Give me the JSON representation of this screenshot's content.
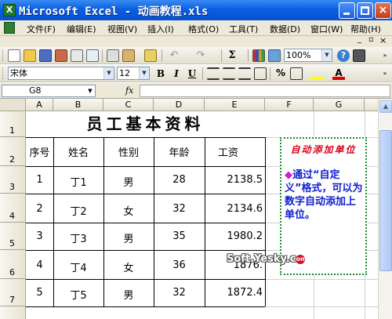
{
  "window": {
    "title": "Microsoft Excel - 动画教程.xls",
    "app_icon": "excel-icon"
  },
  "menu": {
    "items": [
      "文件(F)",
      "编辑(E)",
      "视图(V)",
      "插入(I)",
      "格式(O)",
      "工具(T)",
      "数据(D)",
      "窗口(W)",
      "帮助(H)"
    ],
    "mdi_controls": [
      "_",
      "▫",
      "×"
    ]
  },
  "toolbar": {
    "zoom": "100%",
    "font_name": "宋体",
    "font_size": "12",
    "bold": "B",
    "italic": "I",
    "underline": "U",
    "percent": "%",
    "sigma": "Σ",
    "accent_colors": {
      "fill": "#ffff00",
      "font": "#e00000"
    }
  },
  "formula_bar": {
    "cell_ref": "G8",
    "fx": "fx",
    "content": ""
  },
  "sheet": {
    "columns": [
      "A",
      "B",
      "C",
      "D",
      "E",
      "F",
      "G"
    ],
    "rows": [
      "1",
      "2",
      "3",
      "4",
      "5",
      "6",
      "7"
    ],
    "title": "员工基本资料",
    "headers": [
      "序号",
      "姓名",
      "性别",
      "年龄",
      "工资"
    ],
    "data": [
      [
        "1",
        "丁1",
        "男",
        "28",
        "2138.5"
      ],
      [
        "2",
        "丁2",
        "女",
        "32",
        "2134.6"
      ],
      [
        "3",
        "丁3",
        "男",
        "35",
        "1980.2"
      ],
      [
        "4",
        "丁4",
        "女",
        "36",
        "1876."
      ],
      [
        "5",
        "丁5",
        "男",
        "32",
        "1872.4"
      ]
    ]
  },
  "note": {
    "title": "自动添加单位",
    "bullet": "◆",
    "body": "通过“自定义”格式，可以为数字自动添加上单位。"
  },
  "watermark": {
    "text": "Soft.Yesky.c",
    "badge": "om"
  }
}
